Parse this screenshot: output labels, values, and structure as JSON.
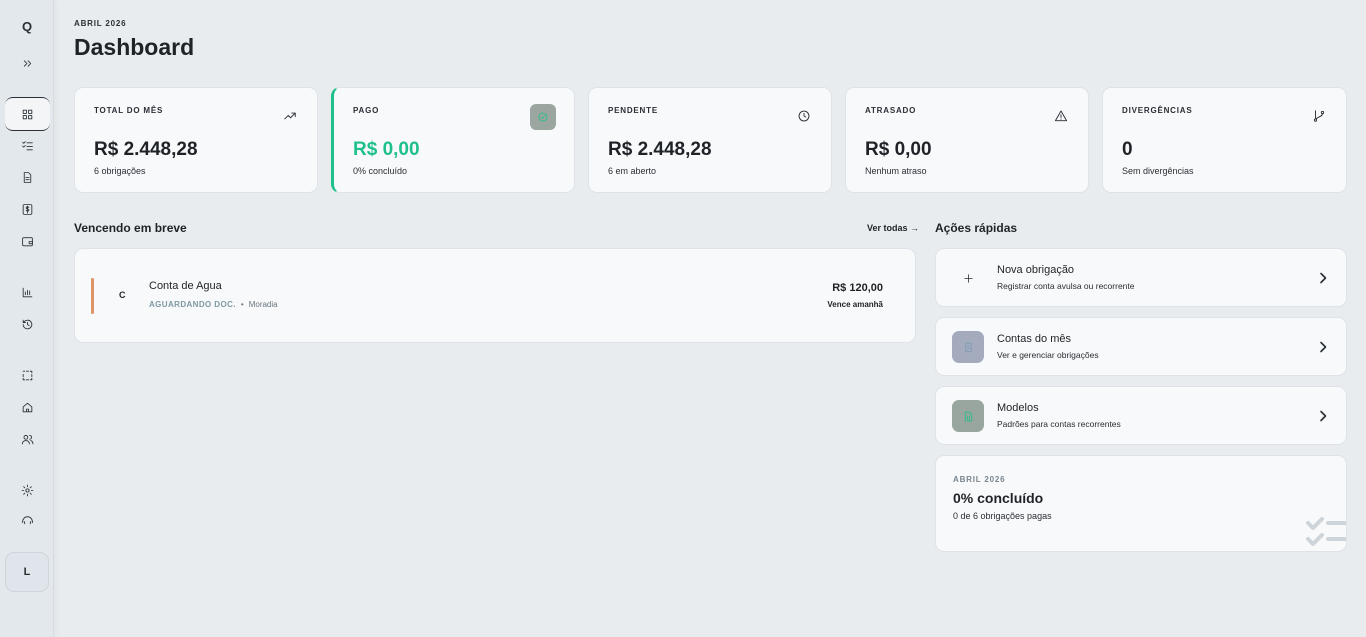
{
  "sidebar": {
    "logo": "Q",
    "user_initial": "L"
  },
  "header": {
    "eyebrow": "ABRIL 2026",
    "title": "Dashboard"
  },
  "stats": [
    {
      "label": "TOTAL DO MÊS",
      "value": "R$ 2.448,28",
      "sub": "6 obrigações",
      "icon": "trending-up-icon"
    },
    {
      "label": "PAGO",
      "value": "R$ 0,00",
      "sub": "0% concluído",
      "icon": "check-circle-icon",
      "accent": "#1fc08b"
    },
    {
      "label": "PENDENTE",
      "value": "R$ 2.448,28",
      "sub": "6 em aberto",
      "icon": "clock-icon"
    },
    {
      "label": "ATRASADO",
      "value": "R$ 0,00",
      "sub": "Nenhum atraso",
      "icon": "alert-triangle-icon"
    },
    {
      "label": "DIVERGÊNCIAS",
      "value": "0",
      "sub": "Sem divergências",
      "icon": "git-branch-icon"
    }
  ],
  "upcoming": {
    "title": "Vencendo em breve",
    "see_all": "Ver todas →",
    "items": [
      {
        "letter": "C",
        "name": "Conta de Agua",
        "status": "AGUARDANDO DOC.",
        "separator": "•",
        "category": "Moradia",
        "amount": "R$ 120,00",
        "due": "Vence amanhã",
        "accent": "#e09466"
      }
    ]
  },
  "quick_actions": {
    "title": "Ações rápidas",
    "items": [
      {
        "title": "Nova obrigação",
        "sub": "Registrar conta avulsa ou recorrente",
        "icon": "plus-icon"
      },
      {
        "title": "Contas do mês",
        "sub": "Ver e gerenciar obrigações",
        "icon": "receipt-icon"
      },
      {
        "title": "Modelos",
        "sub": "Padrões para contas recorrentes",
        "icon": "template-icon"
      }
    ]
  },
  "progress": {
    "eyebrow": "ABRIL 2026",
    "title": "0% concluído",
    "sub": "0 de 6 obrigações pagas",
    "percent": 0
  },
  "colors": {
    "success": "#1fc08b",
    "warning": "#e09466",
    "background": "#e8ecef"
  }
}
